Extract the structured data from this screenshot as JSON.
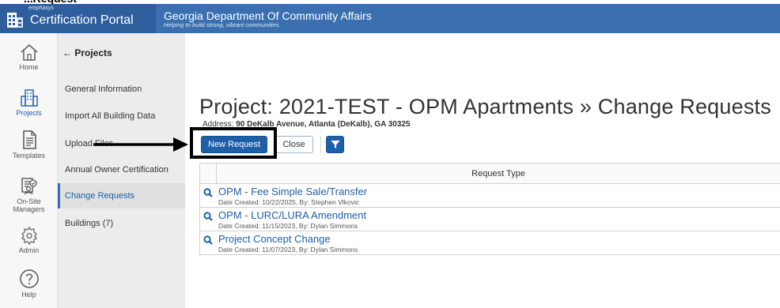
{
  "header": {
    "brand_small": "emphasys",
    "brand_title": "Certification Portal",
    "org_title": "Georgia Department Of Community Affairs",
    "org_tagline": "Helping to build strong, vibrant communities."
  },
  "rail": {
    "items": [
      {
        "label": "Home",
        "icon": "home-icon"
      },
      {
        "label": "Projects",
        "icon": "building-icon"
      },
      {
        "label": "Templates",
        "icon": "document-icon"
      },
      {
        "label": "On-Site Managers",
        "icon": "managers-icon"
      },
      {
        "label": "Admin",
        "icon": "gear-icon"
      },
      {
        "label": "Help",
        "icon": "help-icon"
      }
    ]
  },
  "subnav": {
    "back_label": "← Projects",
    "items": [
      {
        "label": "General Information"
      },
      {
        "label": "Import All Building Data"
      },
      {
        "label": "Upload Files"
      },
      {
        "label": "Annual Owner Certification"
      },
      {
        "label": "Change Requests",
        "active": true
      },
      {
        "label": "Buildings (7)"
      }
    ]
  },
  "main": {
    "title": "Project: 2021-TEST - OPM Apartments » Change Requests",
    "address_label": "Address:",
    "address_value": "90 DeKalb Avenue, Atlanta (DeKalb), GA 30325",
    "new_request_label": "New Request",
    "close_label": "Close",
    "table": {
      "column_header": "Request Type",
      "rows": [
        {
          "title": "OPM - Fee Simple Sale/Transfer",
          "meta": "Date Created: 10/22/2025, By: Stephen Vlkovic"
        },
        {
          "title": "OPM - LURC/LURA Amendment",
          "meta": "Date Created: 11/15/2023, By: Dylan Simmons"
        },
        {
          "title": "Project Concept Change",
          "meta": "Date Created: 11/07/2023, By: Dylan Simmons"
        }
      ]
    }
  },
  "colors": {
    "header_blue": "#3a6fb0",
    "accent_blue": "#1f5fa8",
    "sidebar_bg": "#ececec"
  }
}
